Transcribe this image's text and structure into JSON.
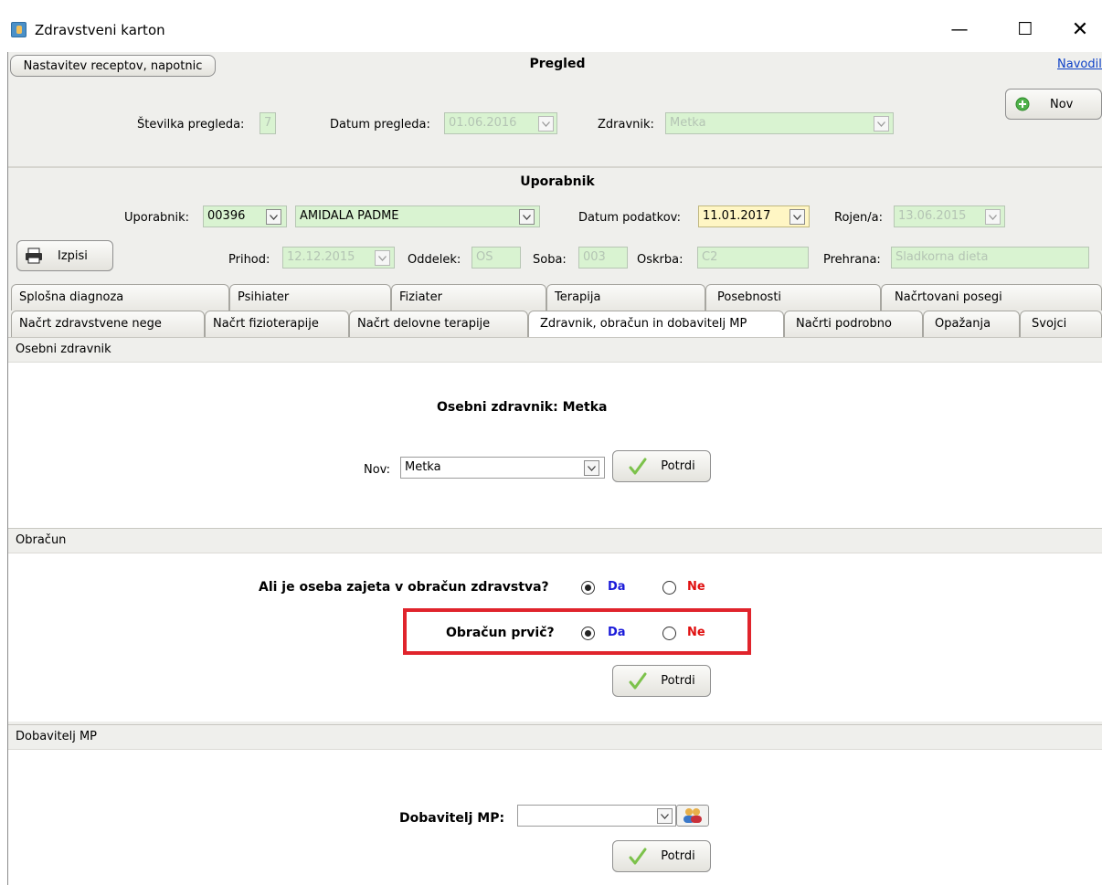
{
  "window": {
    "title": "Zdravstveni karton",
    "minimize": "—",
    "maximize": "☐",
    "close": "✕"
  },
  "pregled": {
    "left_button": "Nastavitev receptov, napotnic",
    "title": "Pregled",
    "help_link": "Navodila",
    "nov_button": "Nov",
    "stevilka_label": "Številka pregleda:",
    "stevilka_value": "7",
    "datum_label": "Datum pregleda:",
    "datum_value": "01.06.2016",
    "zdravnik_label": "Zdravnik:",
    "zdravnik_value": "Metka"
  },
  "uporabnik": {
    "title": "Uporabnik",
    "uporabnik_label": "Uporabnik:",
    "uporabnik_id": "00396",
    "uporabnik_name": "AMIDALA PADME",
    "datum_podatkov_label": "Datum podatkov:",
    "datum_podatkov_value": "11.01.2017",
    "rojen_label": "Rojen/a:",
    "rojen_value": "13.06.2015",
    "izpisi_button": "Izpisi",
    "prihod_label": "Prihod:",
    "prihod_value": "12.12.2015",
    "oddelek_label": "Oddelek:",
    "oddelek_value": "OS",
    "soba_label": "Soba:",
    "soba_value": "003",
    "oskrba_label": "Oskrba:",
    "oskrba_value": "C2",
    "prehrana_label": "Prehrana:",
    "prehrana_value": "Sladkorna dieta"
  },
  "tabs_row1": [
    "Splošna diagnoza",
    "Psihiater",
    "Fiziater",
    "Terapija",
    "Posebnosti",
    "Načrtovani posegi"
  ],
  "tabs_row2": [
    "Načrt zdravstvene nege",
    "Načrt fizioterapije",
    "Načrt delovne terapije",
    "Zdravnik, obračun in dobavitelj MP",
    "Načrti podrobno",
    "Opažanja",
    "Svojci"
  ],
  "osebni": {
    "header": "Osebni zdravnik",
    "current_label": "Osebni zdravnik:",
    "current_value": "Metka",
    "nov_label": "Nov:",
    "nov_value": "Metka",
    "potrdi": "Potrdi"
  },
  "obracun": {
    "header": "Obračun",
    "question1": "Ali je oseba zajeta v obračun zdravstva?",
    "question2": "Obračun prvič?",
    "da": "Da",
    "ne": "Ne",
    "potrdi": "Potrdi",
    "highlight_color": "#e0242c"
  },
  "dobavitelj": {
    "header": "Dobavitelj MP",
    "label": "Dobavitelj MP:",
    "value": "",
    "potrdi": "Potrdi"
  }
}
